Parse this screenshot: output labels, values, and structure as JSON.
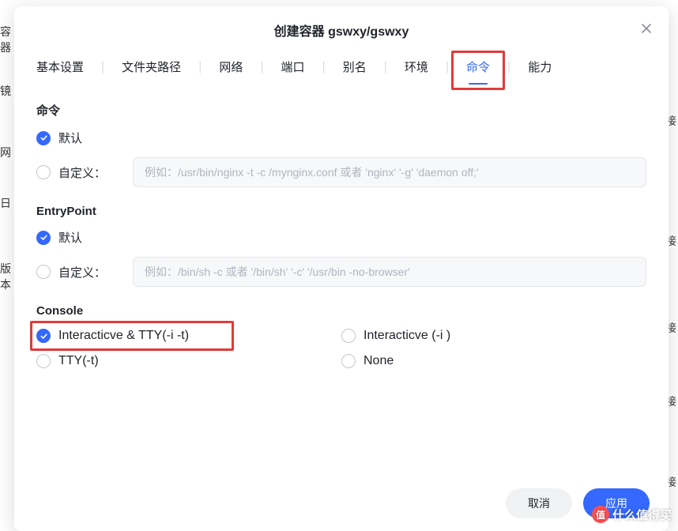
{
  "modal": {
    "title": "创建容器 gswxy/gswxy"
  },
  "tabs": {
    "items": [
      "基本设置",
      "文件夹路径",
      "网络",
      "端口",
      "别名",
      "环境",
      "命令",
      "能力"
    ],
    "active_index": 6
  },
  "command": {
    "title": "命令",
    "default_label": "默认",
    "custom_label": "自定义：",
    "custom_placeholder": "例如：/usr/bin/nginx -t -c /mynginx.conf 或者 'nginx' '-g' 'daemon off;'",
    "selected": "default"
  },
  "entrypoint": {
    "title": "EntryPoint",
    "default_label": "默认",
    "custom_label": "自定义：",
    "custom_placeholder": "例如：/bin/sh -c 或者 '/bin/sh' '-c' '/usr/bin -no-browser'",
    "selected": "default"
  },
  "console": {
    "title": "Console",
    "options": {
      "it": "Interacticve & TTY(-i -t)",
      "i": "Interacticve (-i )",
      "t": "TTY(-t)",
      "none": "None"
    },
    "selected": "it"
  },
  "footer": {
    "cancel": "取消",
    "confirm": "应用"
  },
  "bg": {
    "left0": "容器",
    "left1": "镜",
    "left2": "网",
    "left3": "日",
    "left4": "版本",
    "link": "链接"
  },
  "watermark": {
    "badge": "值",
    "text": "什么值得买"
  }
}
